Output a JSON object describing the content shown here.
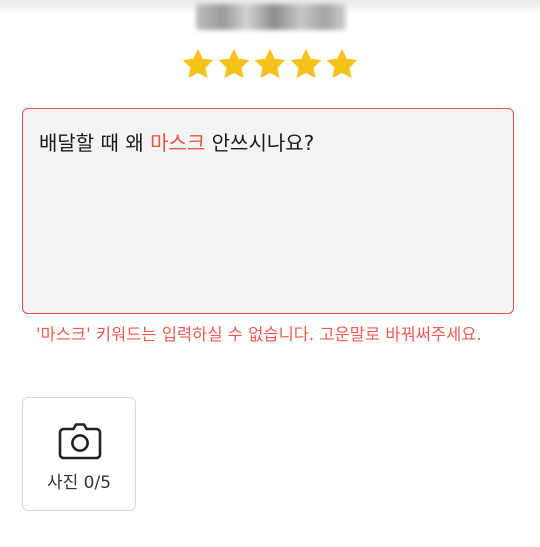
{
  "rating": {
    "value": 5,
    "max": 5,
    "star_color": "#f5c21b"
  },
  "review": {
    "text_before": "배달할 때 왜 ",
    "keyword": "마스크",
    "text_after": " 안쓰시나요?",
    "keyword_color": "#e8504a"
  },
  "error": {
    "message": "'마스크' 키워드는 입력하실 수 없습니다. 고운말로 바꿔써주세요.",
    "color": "#ec5a52"
  },
  "photo_upload": {
    "icon": "camera-icon",
    "label": "사진 0/5"
  }
}
